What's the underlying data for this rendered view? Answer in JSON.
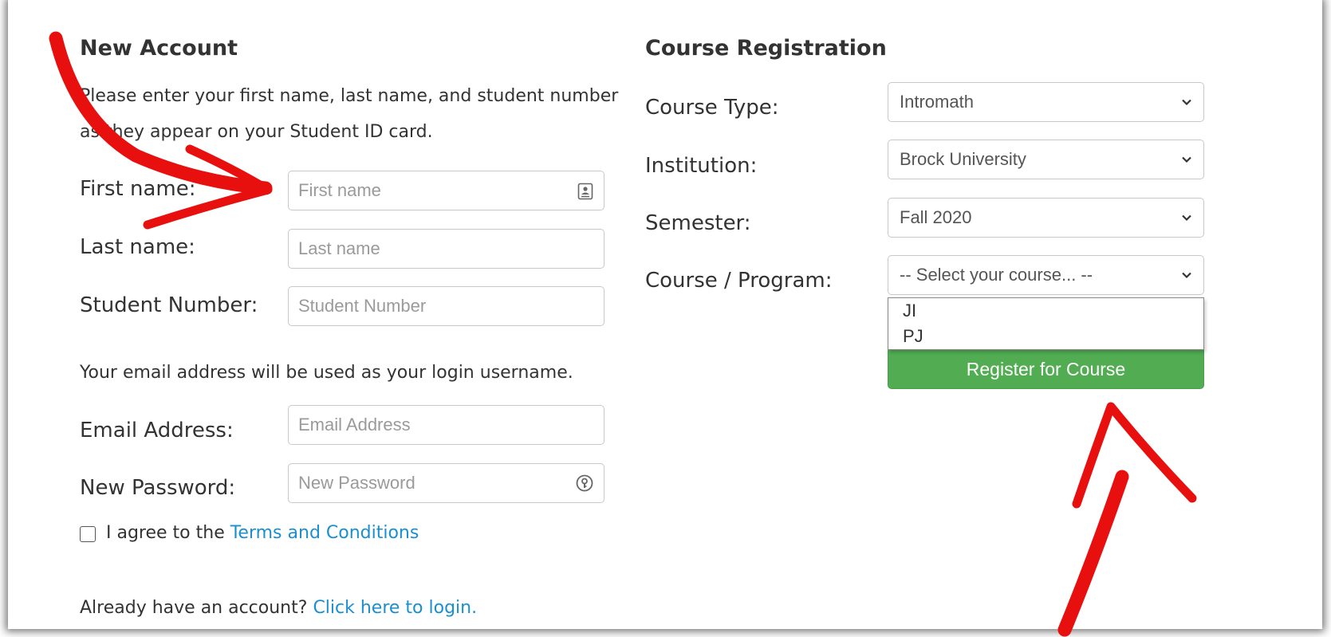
{
  "new_account": {
    "title": "New Account",
    "intro_line1": "Please enter your first name, last name, and student number",
    "intro_line2": "as they appear on your Student ID card.",
    "first_name_label": "First name:",
    "first_name_placeholder": "First name",
    "last_name_label": "Last name:",
    "last_name_placeholder": "Last name",
    "student_number_label": "Student Number:",
    "student_number_placeholder": "Student Number",
    "email_note": "Your email address will be used as your login username.",
    "email_label": "Email Address:",
    "email_placeholder": "Email Address",
    "password_label": "New Password:",
    "password_placeholder": "New Password",
    "agree_prefix": "I agree to the ",
    "terms_link": "Terms and Conditions",
    "have_account": "Already have an account? ",
    "login_link": "Click here to login."
  },
  "course_registration": {
    "title": "Course Registration",
    "course_type_label": "Course Type:",
    "course_type_value": "Intromath",
    "institution_label": "Institution:",
    "institution_value": "Brock University",
    "semester_label": "Semester:",
    "semester_value": "Fall 2020",
    "program_label": "Course / Program:",
    "program_value": "-- Select your course... --",
    "program_options": [
      "JI",
      "PJ"
    ],
    "register_button": "Register for Course"
  },
  "colors": {
    "link": "#1a8fd0",
    "button_green": "#52ad52",
    "annotation_red": "#e8100f"
  },
  "icons": [
    "contact-card-icon",
    "password-key-icon",
    "chevron-down-icon",
    "annotation-arrow"
  ]
}
